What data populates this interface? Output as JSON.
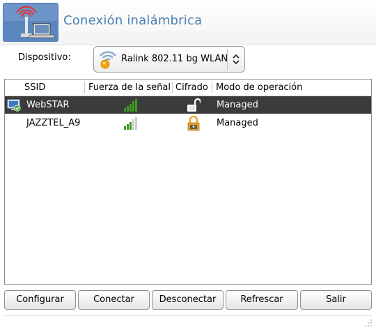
{
  "window": {
    "title": "Conexión inalámbrica",
    "header_icon": "wireless-network-icon"
  },
  "device": {
    "label": "Dispositivo:",
    "selected": "Ralink 802.11 bg WLAN",
    "icon": "wifi-device-icon"
  },
  "table": {
    "columns": [
      "SSID",
      "Fuerza de la señal",
      "Cifrado",
      "Modo de operación"
    ],
    "rows": [
      {
        "ssid": "WebSTAR",
        "signal": 1.0,
        "encryption": "open-lock-icon",
        "mode": "Managed",
        "selected": true,
        "connected_icon": "connected-monitor-icon"
      },
      {
        "ssid": "JAZZTEL_A9",
        "signal": 0.5,
        "encryption": "closed-lock-icon",
        "mode": "Managed",
        "selected": false
      }
    ]
  },
  "buttons": {
    "configure": "Configurar",
    "connect": "Conectar",
    "disconnect": "Desconectar",
    "refresh": "Refrescar",
    "exit": "Salir"
  },
  "colors": {
    "title": "#4a7fb5",
    "selection": "#3b3b3b",
    "signal_on": "#3d9a1f",
    "signal_off": "#cfcfcf",
    "lock": "#e8a020"
  }
}
